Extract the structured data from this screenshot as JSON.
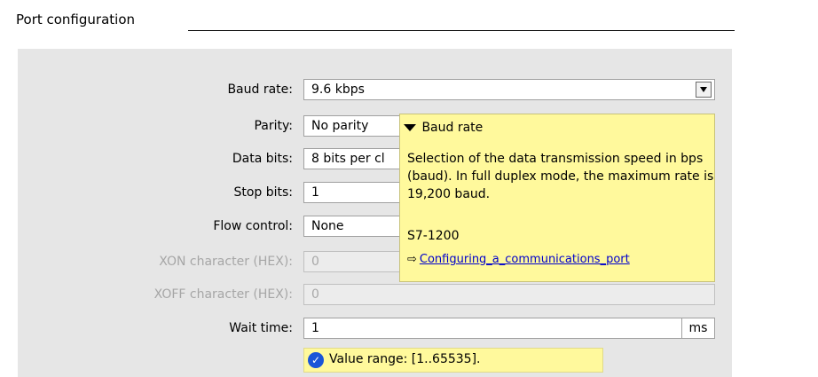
{
  "section": {
    "title": "Port configuration"
  },
  "fields": [
    {
      "label": "Baud rate:",
      "value": "9.6 kbps",
      "kind": "dropdown",
      "enabled": true
    },
    {
      "label": "Parity:",
      "value": "No parity",
      "kind": "dropdown",
      "enabled": true
    },
    {
      "label": "Data bits:",
      "value": "8 bits per cl",
      "kind": "dropdown",
      "enabled": true
    },
    {
      "label": "Stop bits:",
      "value": "1",
      "kind": "dropdown",
      "enabled": true
    },
    {
      "label": "Flow control:",
      "value": "None",
      "kind": "dropdown",
      "enabled": true
    },
    {
      "label": "XON character (HEX):",
      "value": "0",
      "kind": "text",
      "enabled": false
    },
    {
      "label": "XOFF character (HEX):",
      "value": "0",
      "kind": "text",
      "enabled": false
    },
    {
      "label": "Wait time:",
      "value": "1",
      "unit": "ms",
      "kind": "text",
      "enabled": true
    }
  ],
  "tooltip": {
    "title": "Baud rate",
    "lines": [
      "Selection of the data transmission speed in bps",
      "(baud). In full duplex mode, the maximum rate is",
      "19,200 baud."
    ],
    "device": "S7-1200",
    "link": "Configuring_a_communications_port",
    "link_icon": "arrow-right-icon"
  },
  "hint": {
    "text": "Value range: [1..65535].",
    "icon": "check-icon"
  },
  "colors": {
    "panel": "#e6e6e6",
    "tooltip": "#fff99c",
    "link": "#0000cc",
    "hint_icon": "#1a55d8"
  }
}
